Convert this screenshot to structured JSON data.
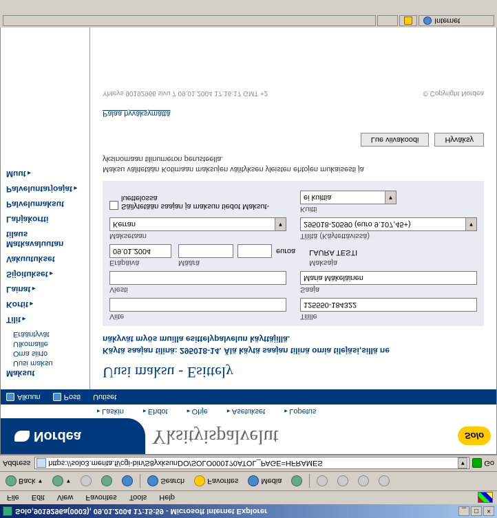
{
  "window": {
    "title": "Solo,9019296a(0003), 09.01.2004 17:15:59 - Microsoft Internet Explorer"
  },
  "menu": {
    "file": "File",
    "edit": "Edit",
    "view": "View",
    "favorites": "Favorites",
    "tools": "Tools",
    "help": "Help"
  },
  "toolbar": {
    "back": "Back",
    "search": "Search",
    "favorites": "Favorites",
    "media": "Media"
  },
  "address": {
    "label": "Address",
    "url": "https://solo3.merita.fi/cgi-bin/S8yxksunDO/SOLO0001?0ATOL_PAGE=HFRAMES",
    "go": "Go"
  },
  "brand": {
    "nordea": "Nordea",
    "service": "Yksityispalvelut",
    "solo": "Solo"
  },
  "toplinks": {
    "l1": "Laskin",
    "l2": "Ehdot",
    "l3": "Ohje",
    "l4": "Asetukset",
    "l5": "Lopetus"
  },
  "bluebar": {
    "b1": "Alkuun",
    "b2": "Posti",
    "b3": "Uutiset"
  },
  "sidebar": {
    "s1": "Maksut",
    "s1a": "Uusi maksu",
    "s1b": "Oma siirto",
    "s1c": "Ulkomaille",
    "s1d": "Erääntyvät",
    "s2": "Tilit",
    "s3": "Kortit",
    "s4": "Lainat",
    "s5": "Sijoitukset",
    "s6": "Vakuutukset",
    "s7": "Matkavaluutan tilaus",
    "s8": "Lahjakortti",
    "s9": "Palvelumaksut",
    "s10": "Palveluntarjoajat",
    "s11": "Muut"
  },
  "main": {
    "heading": "Uusi maksu - Esittely",
    "note1": "Käytä saajan tilinä: 295018-14. Älä käytä saajan tilinä omia tilejäsi,sillä ne",
    "note2": "näkyvät myös muilla esittelypalvelun käyttäjillä.",
    "lab_viite": "Viite",
    "val_viite": "",
    "lab_tilille": "Tilille",
    "val_tilille": "125550-184322",
    "lab_viesti": "Viesti",
    "val_viesti": "",
    "lab_saaja": "Saaja",
    "val_saaja": "Maria Mäkeläinen",
    "lab_era": "Eräpäivä",
    "val_era": "09.01.2004",
    "lab_maara": "Määrä",
    "val_maara": "",
    "val_maara2": "",
    "cur": "euroa",
    "lab_maksaja": "Maksaja",
    "val_maksaja": "LAURA TESTI",
    "lab_maksetaan": "Maksetaan",
    "val_maksetaan": "Kerran",
    "lab_tililta": "Tililtä (Käytettävissä)",
    "val_tililta": "295018-20590   (euro 9.107,45+)",
    "chk": "Säilytetään saajan ja maksun tiedot Maksut-luettelossa",
    "lab_kuitti": "Kuitti",
    "val_kuitti": "ei kuittia",
    "disc1": "Maksu välitetään Kotimaan maksujen välityksen yleisten ehtojen mukaisesti ja",
    "disc2": "yksinomaan tilinumeron perusteella.",
    "btn_lue": "Lue viivakoodi",
    "btn_hyv": "Hyväksy",
    "back": "Palaa hyväksymättä",
    "foot_l": "Yhteys 90192966 sivu 7 09.01.2004 17:16:17 GMT +2",
    "foot_r": "© Copyright Nordea"
  },
  "status": {
    "zone": "Internet"
  }
}
